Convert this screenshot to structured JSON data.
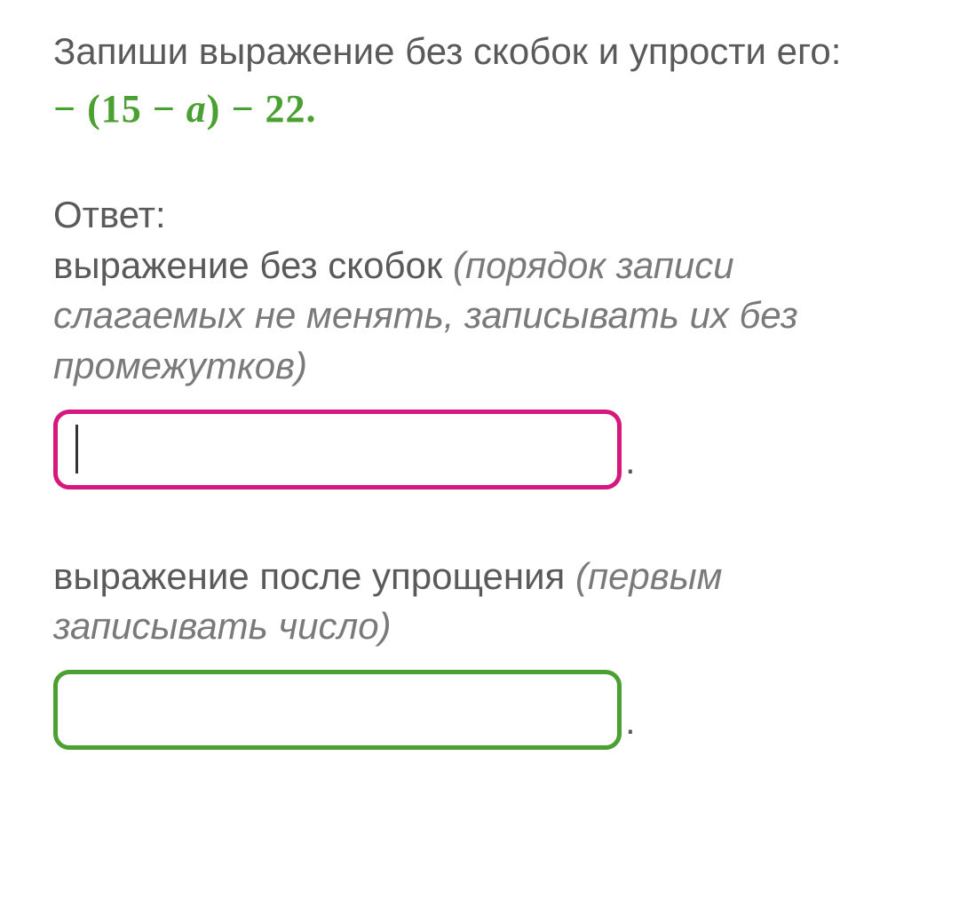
{
  "problem": {
    "prompt": "Запиши выражение без скобок и упрости его:",
    "expression": "− (15 − a) − 22",
    "period": "."
  },
  "answer": {
    "label": "Ответ:",
    "section1": {
      "text": "выражение без скобок ",
      "hint": "(порядок записи слагаемых не менять, записывать их без промежутков)",
      "input_value": "",
      "period": "."
    },
    "section2": {
      "text": "выражение после упрощения ",
      "hint": "(первым записывать число)",
      "input_value": "",
      "period": "."
    }
  }
}
